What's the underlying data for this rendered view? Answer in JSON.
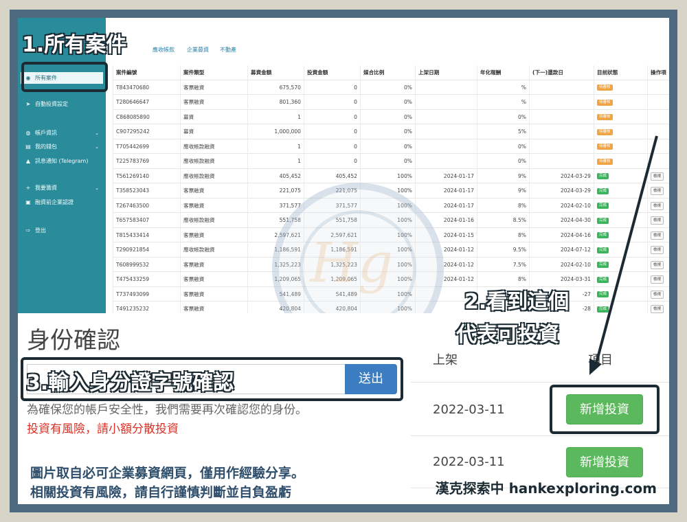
{
  "sidebar": {
    "items": [
      {
        "label": "所有案件",
        "icon": "users-icon"
      },
      {
        "label": "自動投資設定",
        "icon": "rocket-icon"
      },
      {
        "label": "帳戶資訊",
        "icon": "globe-icon"
      },
      {
        "label": "我的錢包",
        "icon": "wallet-icon"
      },
      {
        "label": "訊息通知 (Telegram)",
        "icon": "bell-icon"
      },
      {
        "label": "我要籌資",
        "icon": "plus-icon"
      },
      {
        "label": "融資前企業認證",
        "icon": "id-card-icon"
      },
      {
        "label": "登出",
        "icon": "logout-icon"
      }
    ]
  },
  "topbar": {
    "tabs": [
      "應收帳款",
      "企業募資",
      "不動產"
    ]
  },
  "table": {
    "headers": [
      "案件編號",
      "案件類型",
      "募資金額",
      "投資金額",
      "媒合比例",
      "上架日期",
      "年化報酬",
      "(下一)還款日",
      "目前狀態",
      "操作項"
    ],
    "rows": [
      [
        "T843470680",
        "客票融資",
        "675,570",
        "0",
        "0%",
        "",
        "%",
        "",
        "待審核",
        ""
      ],
      [
        "T280646647",
        "客票融資",
        "801,360",
        "0",
        "0%",
        "",
        "%",
        "",
        "待審核",
        ""
      ],
      [
        "C868085890",
        "募資",
        "1",
        "0",
        "0%",
        "",
        "0%",
        "",
        "待審核",
        ""
      ],
      [
        "C907295242",
        "募資",
        "1,000,000",
        "0",
        "0%",
        "",
        "5%",
        "",
        "待審核",
        ""
      ],
      [
        "T705442699",
        "應收帳款融資",
        "1",
        "0",
        "0%",
        "",
        "0%",
        "",
        "待審核",
        ""
      ],
      [
        "T225783769",
        "應收帳款融資",
        "1",
        "0",
        "0%",
        "",
        "0%",
        "",
        "待審核",
        ""
      ],
      [
        "T561269140",
        "應收帳款融資",
        "405,452",
        "405,452",
        "100%",
        "2024-01-17",
        "9%",
        "2024-03-29",
        "完成",
        "檢視"
      ],
      [
        "T358523043",
        "客票融資",
        "221,075",
        "221,075",
        "100%",
        "2024-01-17",
        "9%",
        "2024-03-29",
        "完成",
        "檢視"
      ],
      [
        "T267463500",
        "客票融資",
        "371,577",
        "371,577",
        "100%",
        "2024-01-17",
        "8%",
        "2024-02-10",
        "完成",
        "檢視"
      ],
      [
        "T657583407",
        "應收帳款融資",
        "551,758",
        "551,758",
        "100%",
        "2024-01-16",
        "8.5%",
        "2024-04-30",
        "完成",
        "檢視"
      ],
      [
        "T815433414",
        "客票融資",
        "2,597,621",
        "2,597,621",
        "100%",
        "2024-01-15",
        "8%",
        "2024-04-16",
        "完成",
        "檢視"
      ],
      [
        "T290921854",
        "應收帳款融資",
        "1,186,591",
        "1,186,591",
        "100%",
        "2024-01-12",
        "9.5%",
        "2024-07-12",
        "完成",
        "檢視"
      ],
      [
        "T608999532",
        "客票融資",
        "1,325,223",
        "1,325,223",
        "100%",
        "2024-01-12",
        "7.5%",
        "2024-02-10",
        "完成",
        "檢視"
      ],
      [
        "T475433259",
        "客票融資",
        "1,209,065",
        "1,209,065",
        "100%",
        "2024-01-12",
        "8%",
        "2024-03-31",
        "完成",
        "檢視"
      ],
      [
        "T737493099",
        "客票融資",
        "541,489",
        "541,489",
        "100%",
        "2",
        "",
        "-27",
        "完成",
        "檢視"
      ],
      [
        "T491235232",
        "客票融資",
        "420,804",
        "420,804",
        "100%",
        "",
        "",
        "-28",
        "完成",
        "檢視"
      ]
    ]
  },
  "annotations": {
    "step1": "1.所有案件",
    "step2_line1": "2.看到這個",
    "step2_line2": "代表可投資",
    "step3": "3.輸入身分證字號確認"
  },
  "identity": {
    "title": "身份確認",
    "submit_label": "送出",
    "notice": "為確保您的帳戶安全性，我們需要再次確認您的身份。",
    "risk_warning": "投資有風險，請小額分散投資"
  },
  "invest_panel": {
    "header_left": "上架",
    "header_right": "項目",
    "rows": [
      {
        "date": "2022-03-11",
        "button": "新增投資"
      },
      {
        "date": "2022-03-11",
        "button": "新增投資"
      }
    ]
  },
  "footer": {
    "line1": "圖片取自必可企業募資網頁，僅用作經驗分享。",
    "line2": "相關投資有風險，請自行謹慎判斷並自負盈虧",
    "credit": "漢克探索中 hankexploring.com"
  },
  "colors": {
    "sidebar": "#2a8b9a",
    "frame": "#4d6a80",
    "badge_pending": "#f0a545",
    "badge_done": "#3bb35a",
    "invest_button": "#5cb85c",
    "submit_button": "#3b7dc0",
    "risk_text": "#d93025"
  }
}
